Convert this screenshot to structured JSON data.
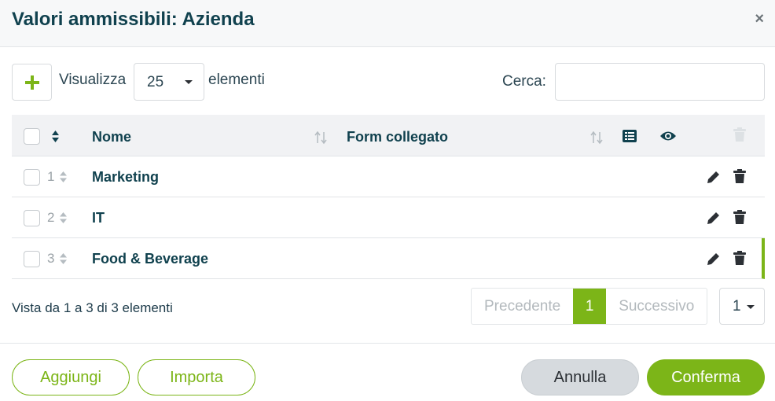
{
  "header": {
    "title": "Valori ammissibili: Azienda",
    "close_label": "×"
  },
  "toolbar": {
    "show_label": "Visualizza",
    "page_size": "25",
    "elements_label": "elementi",
    "search_label": "Cerca:",
    "search_value": ""
  },
  "table": {
    "columns": {
      "name": "Nome",
      "form": "Form collegato"
    },
    "rows": [
      {
        "index": "1",
        "name": "Marketing"
      },
      {
        "index": "2",
        "name": "IT"
      },
      {
        "index": "3",
        "name": "Food & Beverage"
      }
    ]
  },
  "pagination": {
    "info": "Vista da 1 a 3 di 3 elementi",
    "prev": "Precedente",
    "current": "1",
    "next": "Successivo",
    "page_select": "1"
  },
  "footer": {
    "add": "Aggiungi",
    "import": "Importa",
    "cancel": "Annulla",
    "confirm": "Conferma"
  },
  "colors": {
    "accent": "#7cb518",
    "title": "#10414e"
  },
  "icons": [
    "plus-icon",
    "sort-icon",
    "list-icon",
    "eye-icon",
    "trash-icon",
    "pencil-icon",
    "close-icon"
  ]
}
